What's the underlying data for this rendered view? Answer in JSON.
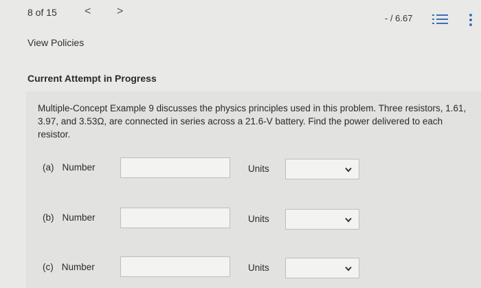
{
  "header": {
    "counter": "8 of 15",
    "prev_glyph": "<",
    "next_glyph": ">",
    "score": "- / 6.67"
  },
  "icons": {
    "prev": "chevron-left-icon",
    "next": "chevron-right-icon",
    "list": "list-icon",
    "menu": "kebab-menu-icon",
    "select_arrow": "chevron-down-icon"
  },
  "links": {
    "view_policies": "View Policies"
  },
  "attempt": {
    "title": "Current Attempt in Progress"
  },
  "question": {
    "text": "Multiple-Concept Example 9 discusses the physics principles used in this problem. Three resistors, 1.61, 3.97, and 3.53Ω, are connected in series across a 21.6-V battery. Find the power delivered to each resistor."
  },
  "parts": [
    {
      "part": "(a)",
      "label": "Number",
      "value": "",
      "units_label": "Units",
      "units_value": ""
    },
    {
      "part": "(b)",
      "label": "Number",
      "value": "",
      "units_label": "Units",
      "units_value": ""
    },
    {
      "part": "(c)",
      "label": "Number",
      "value": "",
      "units_label": "Units",
      "units_value": ""
    }
  ],
  "colors": {
    "background": "#e9e9e8",
    "text": "#2b2b2b",
    "input_border": "#bdbdbd",
    "icon_blue": "#3b6fb6"
  }
}
